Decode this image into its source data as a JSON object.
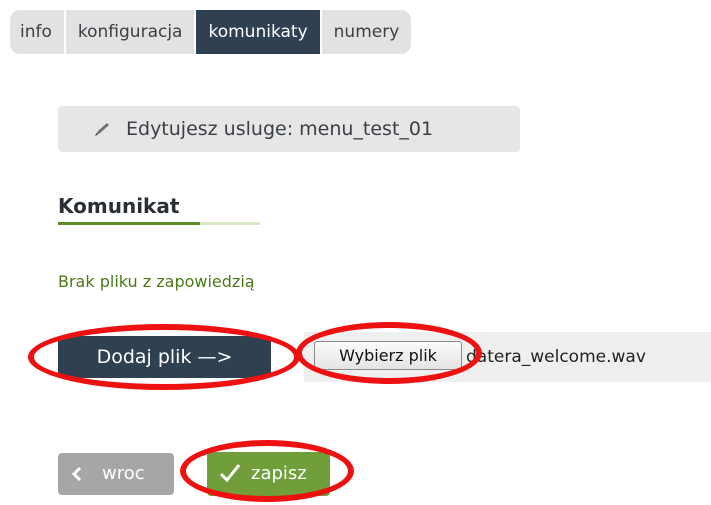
{
  "tabs": [
    {
      "label": "info",
      "active": false
    },
    {
      "label": "konfiguracja",
      "active": false
    },
    {
      "label": "komunikaty",
      "active": true
    },
    {
      "label": "numery",
      "active": false
    }
  ],
  "service_bar": {
    "icon": "pencil-icon",
    "text": "Edytujesz usluge: menu_test_01"
  },
  "section": {
    "title": "Komunikat",
    "no_file_text": "Brak pliku z zapowiedzią"
  },
  "upload": {
    "add_file_label": "Dodaj plik —>",
    "choose_file_label": "Wybierz plik",
    "file_name": "datera_welcome.wav"
  },
  "actions": {
    "back_label": "wroc",
    "save_label": "zapisz"
  },
  "colors": {
    "tab_active": "#2f4050",
    "accent_green": "#6f9e3a",
    "highlight_red": "#ee1111"
  }
}
